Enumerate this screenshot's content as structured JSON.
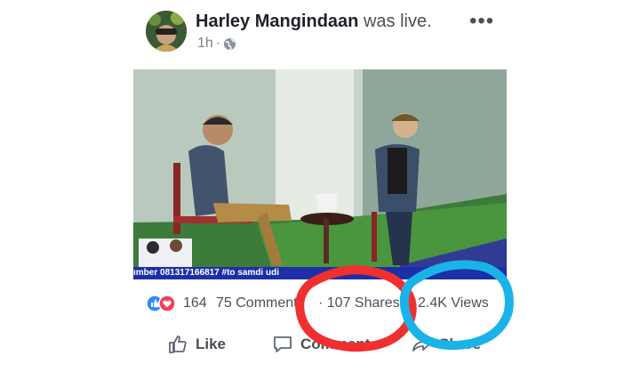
{
  "post": {
    "author": "Harley Mangindaan",
    "status_text": "was live.",
    "timestamp": "1h",
    "separator": "·",
    "privacy_icon": "globe-icon",
    "more_icon": "more-options-icon"
  },
  "video": {
    "ticker_text": "ımber 081317166817   #to   samdi   udi"
  },
  "stats": {
    "reaction_icons": [
      "like-reaction-icon",
      "love-reaction-icon"
    ],
    "reaction_count": "164",
    "comments": "75 Comments",
    "shares": "· 107 Shares",
    "views": "2.4K Views"
  },
  "actions": {
    "like_label": "Like",
    "comment_label": "Comment",
    "share_label": "Share"
  },
  "annotations": {
    "red_circle_color": "#f0302f",
    "blue_circle_color": "#1ab3e8"
  },
  "colors": {
    "like_blue": "#2d88ff",
    "love_red": "#f33e58",
    "ticker_bg": "#1d2fa8"
  }
}
